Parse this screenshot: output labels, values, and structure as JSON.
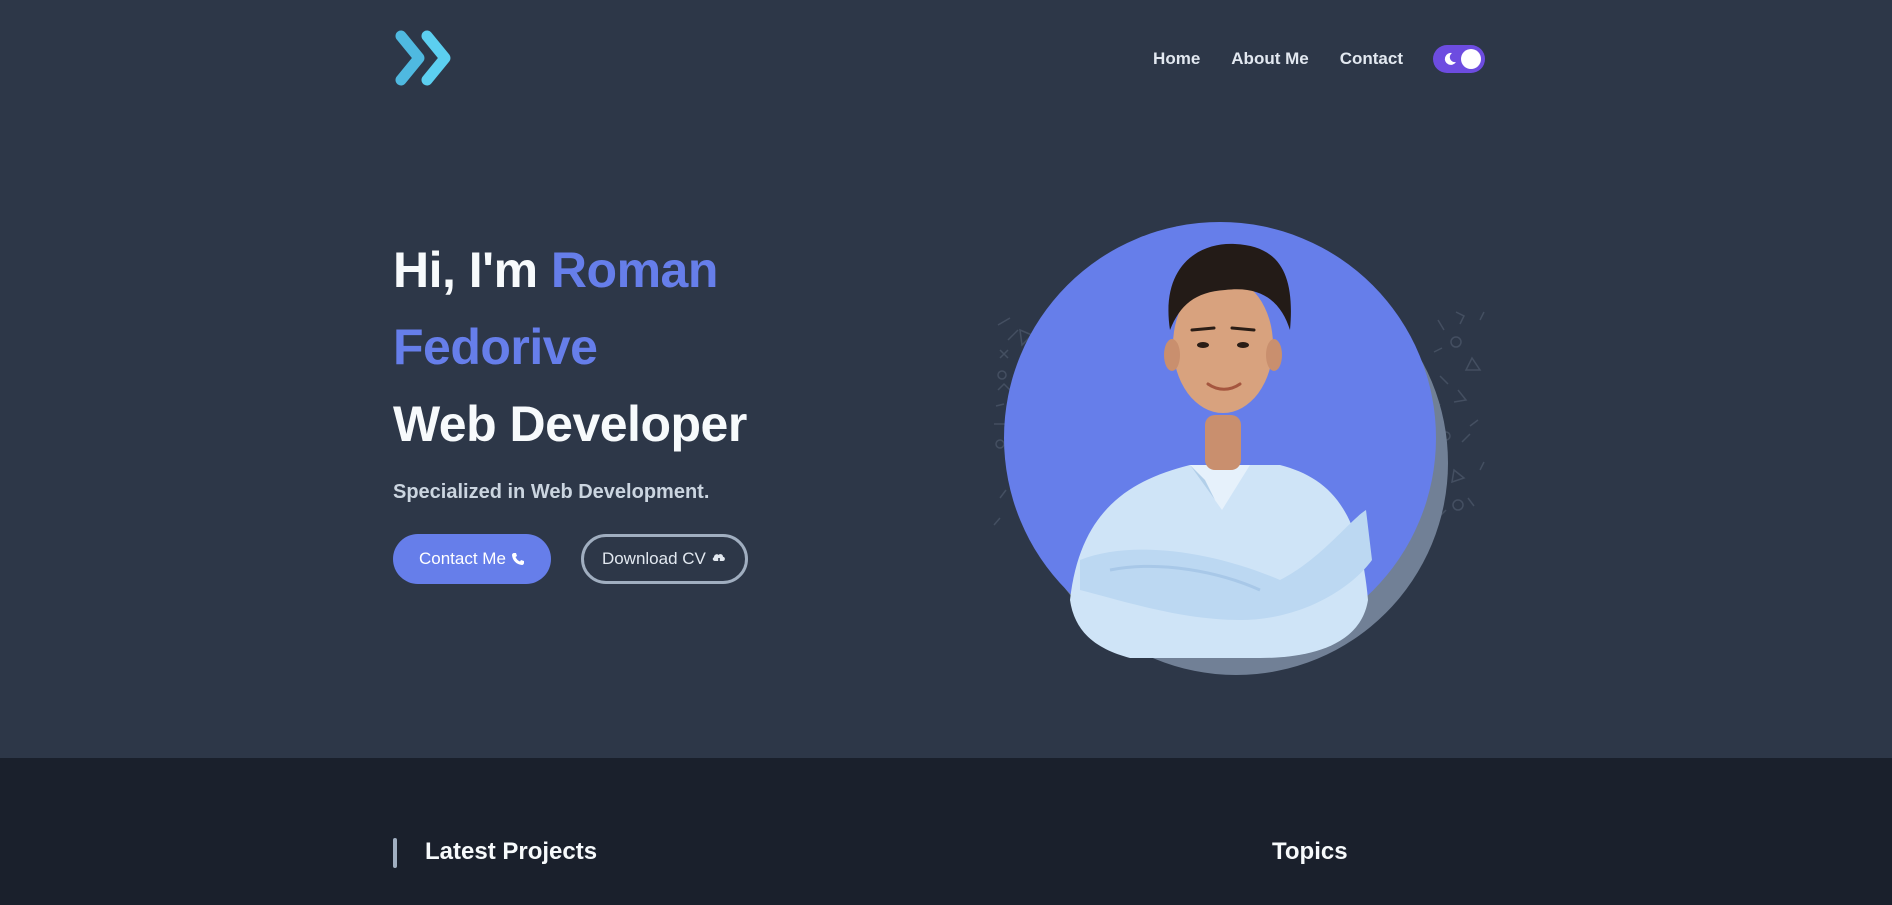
{
  "nav": {
    "items": [
      "Home",
      "About Me",
      "Contact"
    ]
  },
  "theme_toggle": {
    "state": "dark"
  },
  "hero": {
    "greeting": "Hi, I'm ",
    "name_first": "Roman",
    "name_last": "Fedorive",
    "role": "Web Developer",
    "subtitle": "Specialized in Web Development.",
    "contact_button": "Contact Me",
    "download_button": "Download CV"
  },
  "sections": {
    "latest_projects": "Latest Projects",
    "topics": "Topics"
  },
  "colors": {
    "background": "#2d3748",
    "background_dark": "#1a202c",
    "accent": "#667eea",
    "logo_cyan": "#4fc3e8",
    "toggle": "#6d4ce0"
  },
  "icons": [
    "logo-chevrons-icon",
    "moon-icon",
    "phone-icon",
    "cloud-download-icon"
  ]
}
